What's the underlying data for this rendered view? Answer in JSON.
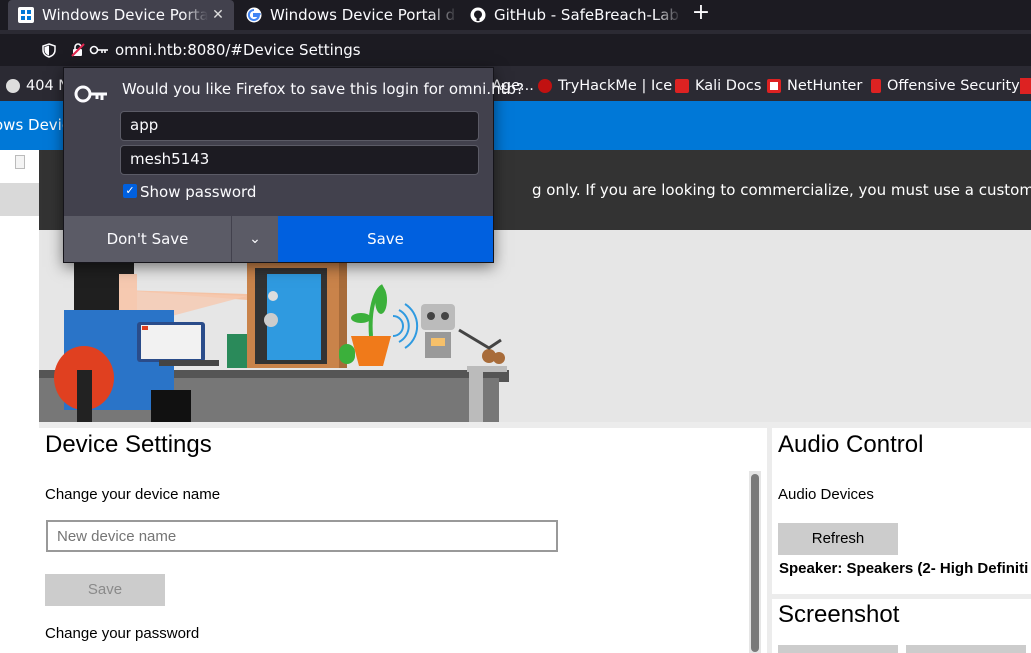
{
  "tabs": [
    {
      "label": "Windows Device Portal",
      "favicon": "wdp-icon",
      "active": true
    },
    {
      "label": "Windows Device Portal d",
      "favicon": "google-icon",
      "active": false
    },
    {
      "label": "GitHub - SafeBreach-Lab",
      "favicon": "github-icon",
      "active": false
    }
  ],
  "address_bar": {
    "url": "omni.htb:8080/#Device Settings"
  },
  "bookmarks": [
    {
      "label": "404 N",
      "icon": "globe-icon"
    },
    {
      "label": "Age...",
      "icon": "page-icon"
    },
    {
      "label": "TryHackMe | Ice",
      "icon": "tryhackme-icon"
    },
    {
      "label": "Kali Docs",
      "icon": "kali-icon"
    },
    {
      "label": "NetHunter",
      "icon": "nethunter-icon"
    },
    {
      "label": "Offensive Security",
      "icon": "offsec-icon"
    }
  ],
  "header": {
    "title": "ows Device"
  },
  "banner": {
    "text": "g only. If you are looking to commercialize, you must use a custom FFU for optim"
  },
  "device_settings": {
    "title": "Device Settings",
    "name_label": "Change your device name",
    "name_placeholder": "New device name",
    "save_label": "Save",
    "password_label": "Change your password"
  },
  "audio_control": {
    "title": "Audio Control",
    "devices_label": "Audio Devices",
    "refresh_label": "Refresh",
    "speaker_text": "Speaker: Speakers (2- High Definiti"
  },
  "screenshot_panel": {
    "title": "Screenshot"
  },
  "save_login_popup": {
    "question": "Would you like Firefox to save this login for omni.htb?",
    "username": "app",
    "password": "mesh5143",
    "show_password_checked": true,
    "show_password_label": "Show password",
    "dont_save_label": "Don't Save",
    "save_label": "Save"
  },
  "colors": {
    "accent_blue": "#0078d7",
    "firefox_blue": "#0060df",
    "banner": "#333333"
  }
}
